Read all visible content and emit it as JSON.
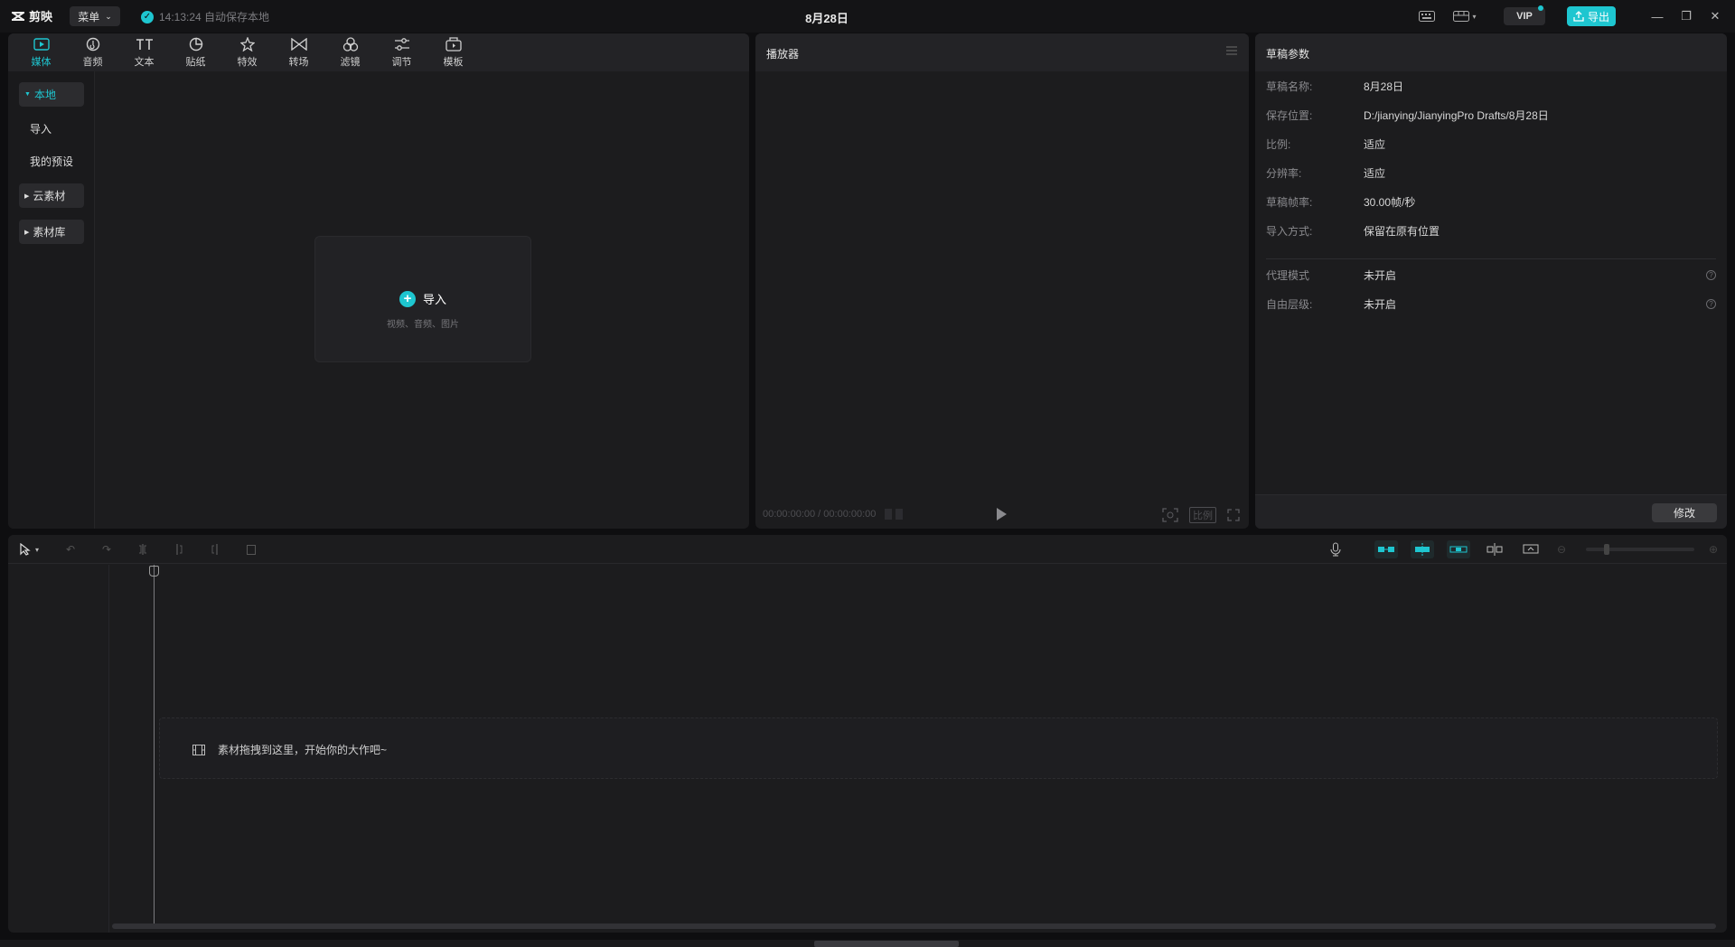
{
  "app": {
    "name": "剪映",
    "menu_label": "菜单",
    "autosave_text": "14:13:24 自动保存本地",
    "project_title": "8月28日",
    "vip_label": "VIP",
    "export_label": "导出"
  },
  "media_tabs": [
    {
      "label": "媒体",
      "icon": "media-icon"
    },
    {
      "label": "音频",
      "icon": "audio-icon"
    },
    {
      "label": "文本",
      "icon": "text-icon"
    },
    {
      "label": "贴纸",
      "icon": "sticker-icon"
    },
    {
      "label": "特效",
      "icon": "effects-icon"
    },
    {
      "label": "转场",
      "icon": "transition-icon"
    },
    {
      "label": "滤镜",
      "icon": "filter-icon"
    },
    {
      "label": "调节",
      "icon": "adjust-icon"
    },
    {
      "label": "模板",
      "icon": "template-icon"
    }
  ],
  "media_sidebar": {
    "local": "本地",
    "import": "导入",
    "presets": "我的预设",
    "cloud": "云素材",
    "library": "素材库"
  },
  "import_box": {
    "label": "导入",
    "sub": "视频、音频、图片"
  },
  "player": {
    "title": "播放器",
    "timecode": "00:00:00:00 / 00:00:00:00",
    "ratio_label": "比例"
  },
  "params": {
    "title": "草稿参数",
    "rows": [
      {
        "k": "草稿名称:",
        "v": "8月28日"
      },
      {
        "k": "保存位置:",
        "v": "D:/jianying/JianyingPro Drafts/8月28日"
      },
      {
        "k": "比例:",
        "v": "适应"
      },
      {
        "k": "分辨率:",
        "v": "适应"
      },
      {
        "k": "草稿帧率:",
        "v": "30.00帧/秒"
      },
      {
        "k": "导入方式:",
        "v": "保留在原有位置"
      },
      {
        "k": "代理模式",
        "v": "未开启"
      },
      {
        "k": "自由层级:",
        "v": "未开启"
      }
    ],
    "modify_label": "修改"
  },
  "timeline": {
    "drop_hint": "素材拖拽到这里，开始你的大作吧~"
  },
  "colors": {
    "accent": "#1ec6d0",
    "panel": "#1c1c1e",
    "background": "#0e0e10"
  }
}
